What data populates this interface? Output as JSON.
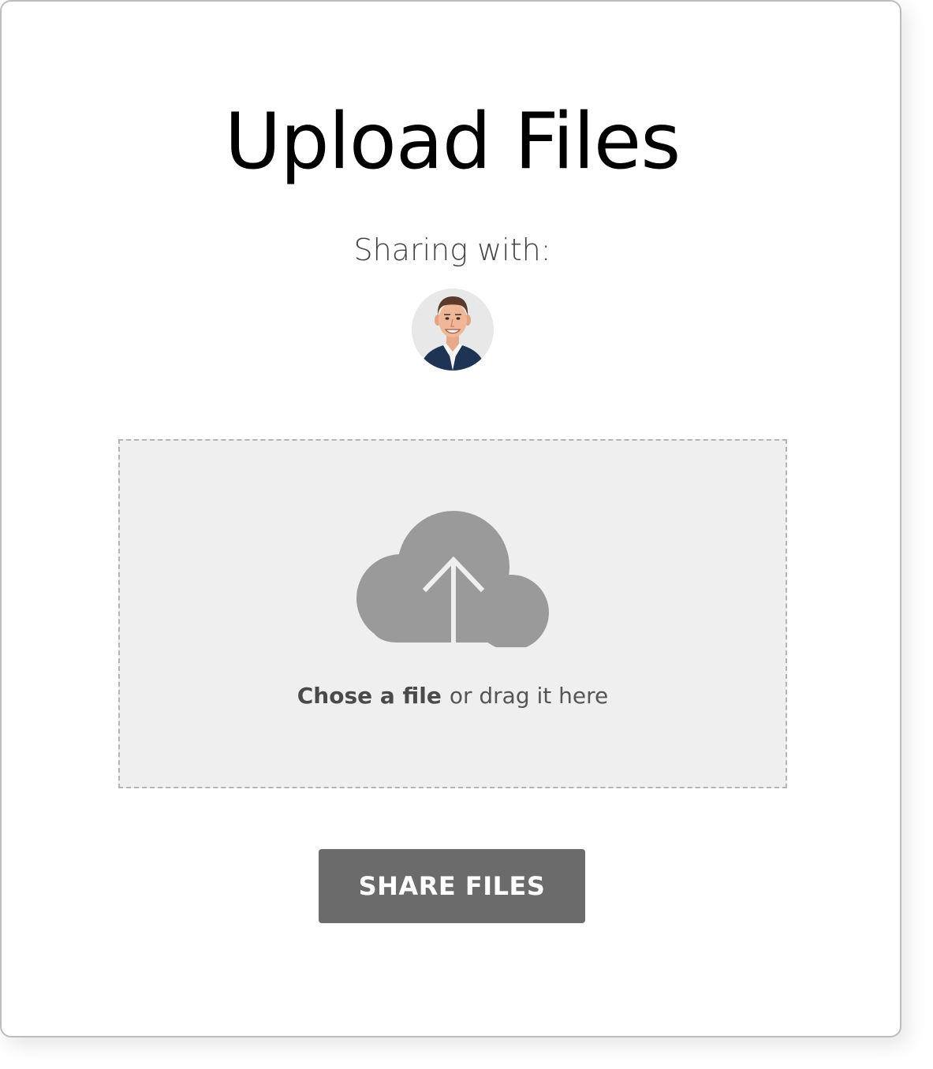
{
  "page": {
    "title": "Upload Files",
    "sharing_label": "Sharing with:"
  },
  "recipient": {
    "avatar_icon": "person-avatar"
  },
  "dropzone": {
    "icon": "cloud-upload-icon",
    "choose_label": "Chose a file",
    "drag_label": "or drag it here"
  },
  "actions": {
    "share_label": "SHARE FILES"
  },
  "colors": {
    "button_bg": "#6b6b6b",
    "dropzone_bg": "#efefef",
    "icon_gray": "#9a9a9a",
    "title_color": "#000000"
  }
}
